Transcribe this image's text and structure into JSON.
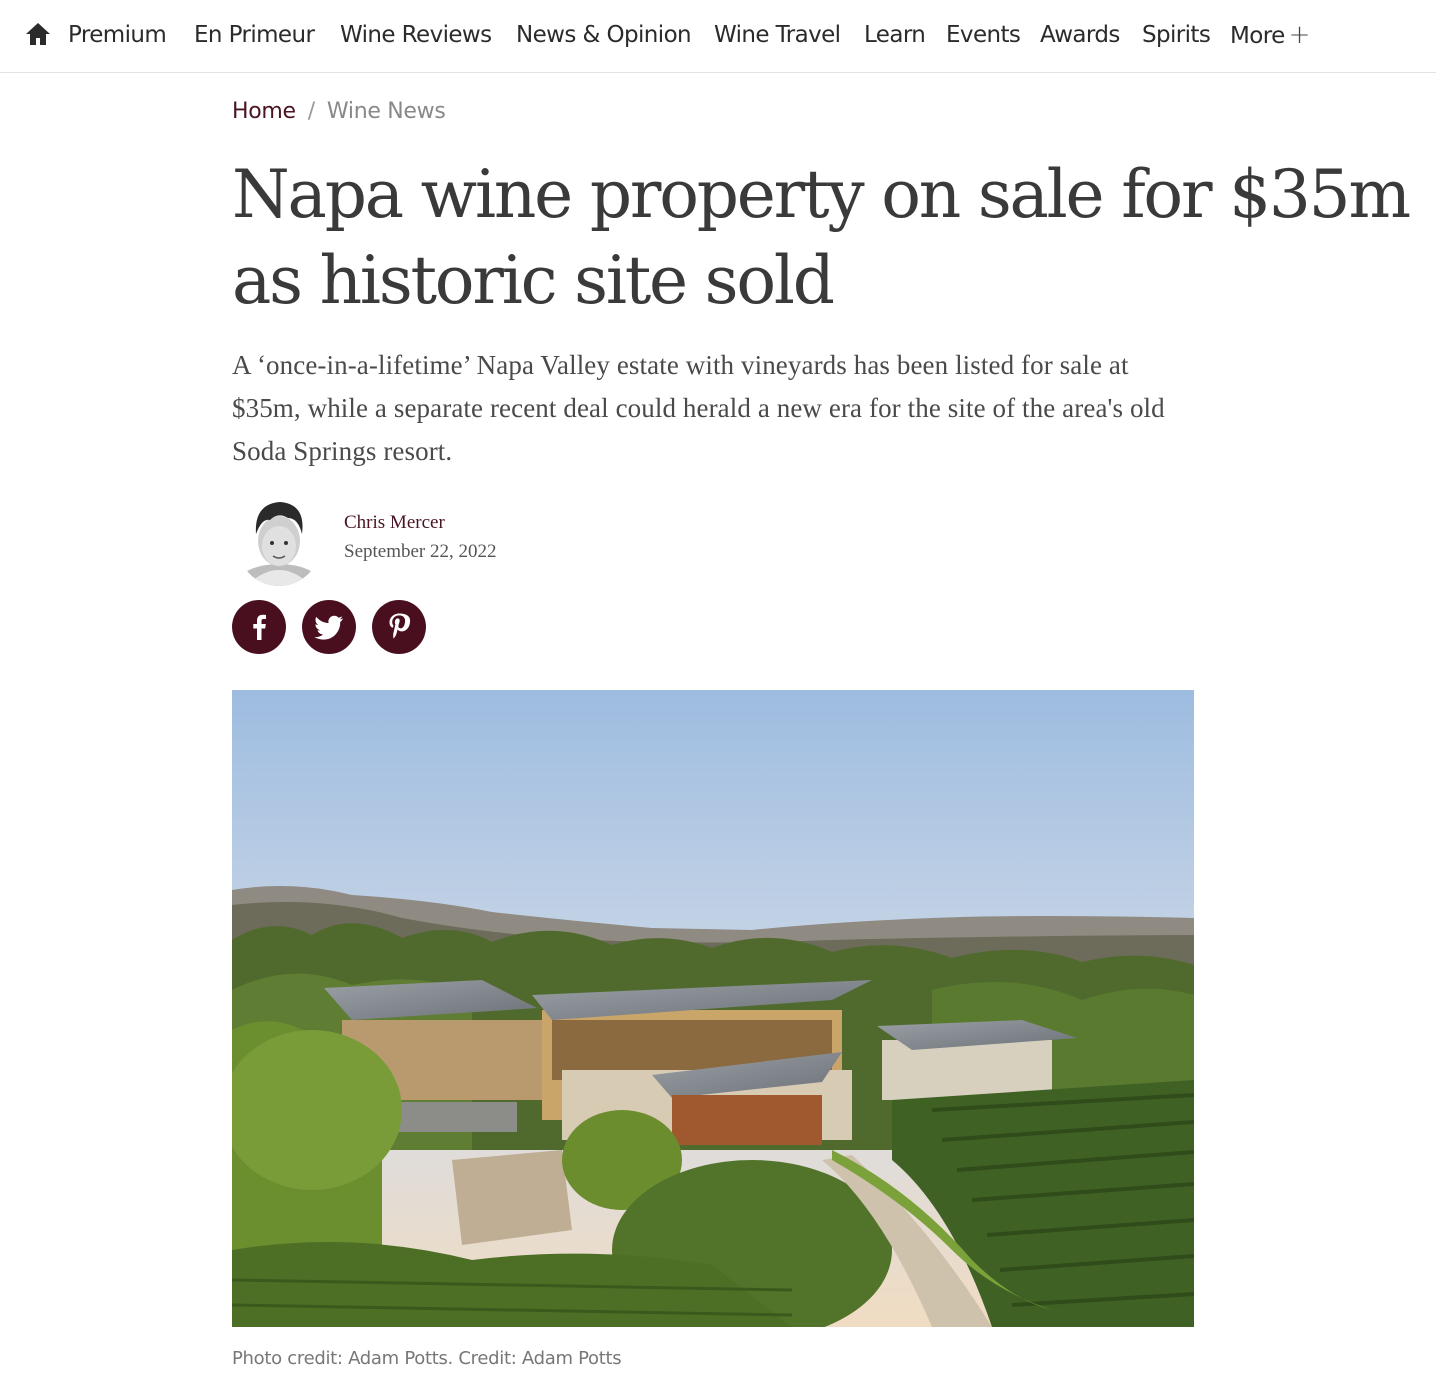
{
  "nav": {
    "home_icon": "home-icon",
    "items": [
      {
        "label": "Premium"
      },
      {
        "label": "En Primeur"
      },
      {
        "label": "Wine Reviews"
      },
      {
        "label": "News & Opinion"
      },
      {
        "label": "Wine Travel"
      },
      {
        "label": "Learn"
      },
      {
        "label": "Events"
      },
      {
        "label": "Awards"
      },
      {
        "label": "Spirits"
      },
      {
        "label": "More"
      }
    ],
    "more_symbol": "+"
  },
  "breadcrumb": {
    "home": "Home",
    "separator": "/",
    "current": "Wine News"
  },
  "article": {
    "headline": "Napa wine property on sale for $35m as historic site sold",
    "standfirst": "A ‘once-in-a-lifetime’ Napa Valley estate with vineyards has been listed for sale at $35m, while a separate recent deal could herald a new era for the site of the area's old Soda Springs resort.",
    "author": "Chris Mercer",
    "date": "September 22, 2022",
    "caption": "Photo credit: Adam Potts. Credit: Adam Potts"
  },
  "social": [
    {
      "icon": "facebook-icon"
    },
    {
      "icon": "twitter-icon"
    },
    {
      "icon": "pinterest-icon"
    }
  ],
  "colors": {
    "brand": "#4a0f1f",
    "breadcrumb_link": "#4a1422",
    "text": "#3a3a3a"
  }
}
